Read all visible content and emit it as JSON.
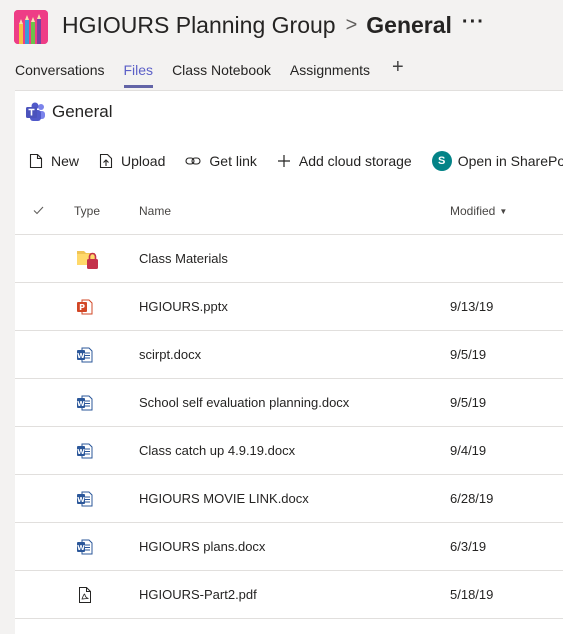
{
  "header": {
    "team_name": "HGIOURS Planning Group",
    "separator": ">",
    "channel_name": "General",
    "more_label": "···"
  },
  "tabs": [
    {
      "label": "Conversations",
      "active": false
    },
    {
      "label": "Files",
      "active": true
    },
    {
      "label": "Class Notebook",
      "active": false
    },
    {
      "label": "Assignments",
      "active": false
    }
  ],
  "tab_add_label": "+",
  "breadcrumb": {
    "label": "General"
  },
  "toolbar": {
    "new_label": "New",
    "upload_label": "Upload",
    "get_link_label": "Get link",
    "add_cloud_label": "Add cloud storage",
    "sharepoint_label": "Open in SharePoint",
    "sharepoint_icon_letter": "S"
  },
  "table": {
    "headers": {
      "type": "Type",
      "name": "Name",
      "modified": "Modified"
    },
    "rows": [
      {
        "icon": "folder-locked-icon",
        "name": "Class Materials",
        "modified": ""
      },
      {
        "icon": "powerpoint-icon",
        "name": "HGIOURS.pptx",
        "modified": "9/13/19"
      },
      {
        "icon": "word-icon",
        "name": "scirpt.docx",
        "modified": "9/5/19"
      },
      {
        "icon": "word-icon",
        "name": "School self evaluation planning.docx",
        "modified": "9/5/19"
      },
      {
        "icon": "word-icon",
        "name": "Class catch up 4.9.19.docx",
        "modified": "9/4/19"
      },
      {
        "icon": "word-icon",
        "name": "HGIOURS MOVIE LINK.docx",
        "modified": "6/28/19"
      },
      {
        "icon": "word-icon",
        "name": "HGIOURS plans.docx",
        "modified": "6/3/19"
      },
      {
        "icon": "pdf-icon",
        "name": "HGIOURS-Part2.pdf",
        "modified": "5/18/19"
      }
    ]
  },
  "colors": {
    "accent": "#6264a7",
    "team_logo": "#ee3d86",
    "word": "#2b579a",
    "powerpoint": "#d24726",
    "sharepoint": "#038387"
  }
}
